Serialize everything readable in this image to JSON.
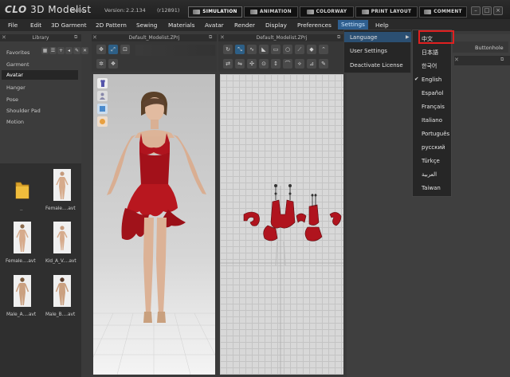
{
  "titlebar": {
    "logo_brand": "CLO",
    "logo_product": "3D Modelist",
    "greeting": "Hello,",
    "version_label": "Version:",
    "version_number": "2.2.134",
    "build": "(r12891)",
    "mode_tabs": [
      "SIMULATION",
      "ANIMATION",
      "COLORWAY",
      "PRINT LAYOUT",
      "COMMENT"
    ],
    "active_mode": "SIMULATION",
    "window_buttons": [
      "–",
      "□",
      "×"
    ]
  },
  "menubar": {
    "items": [
      "File",
      "Edit",
      "3D Garment",
      "2D Pattern",
      "Sewing",
      "Materials",
      "Avatar",
      "Render",
      "Display",
      "Preferences",
      "Settings",
      "Help"
    ],
    "open_item": "Settings"
  },
  "library": {
    "title": "Library",
    "categories": [
      "Favorites",
      "Garment",
      "Avatar",
      "Hanger",
      "Pose",
      "Shoulder Pad",
      "Motion"
    ],
    "selected_category": "Avatar",
    "files": [
      {
        "name": "..",
        "type": "folder"
      },
      {
        "name": "Female....avt",
        "type": "avatar"
      },
      {
        "name": "Female....avt",
        "type": "avatar"
      },
      {
        "name": "Kid_A_V....avt",
        "type": "avatar"
      },
      {
        "name": "Male_A....avt",
        "type": "avatar"
      },
      {
        "name": "Male_B....avt",
        "type": "avatar"
      }
    ]
  },
  "view3d": {
    "title": "Default_Modelist.ZPrj"
  },
  "view2d": {
    "title": "Default_Modelist.ZPrj"
  },
  "right_panel": {
    "label": "Buttonhole"
  },
  "settings_menu": {
    "items": [
      "Language",
      "User Settings",
      "Deactivate License"
    ],
    "submenu_arrow": "▶"
  },
  "language_menu": {
    "items": [
      "中文",
      "日本語",
      "한국어",
      "English",
      "Español",
      "Français",
      "Italiano",
      "Português",
      "русский",
      "Türkçe",
      "العربية",
      "Taiwan"
    ],
    "checked": "English",
    "check_mark": "✔",
    "highlighted": "中文"
  },
  "colors": {
    "dress": "#b0141e",
    "accent_blue": "#2f5f8f",
    "highlight_red": "#e02020"
  }
}
